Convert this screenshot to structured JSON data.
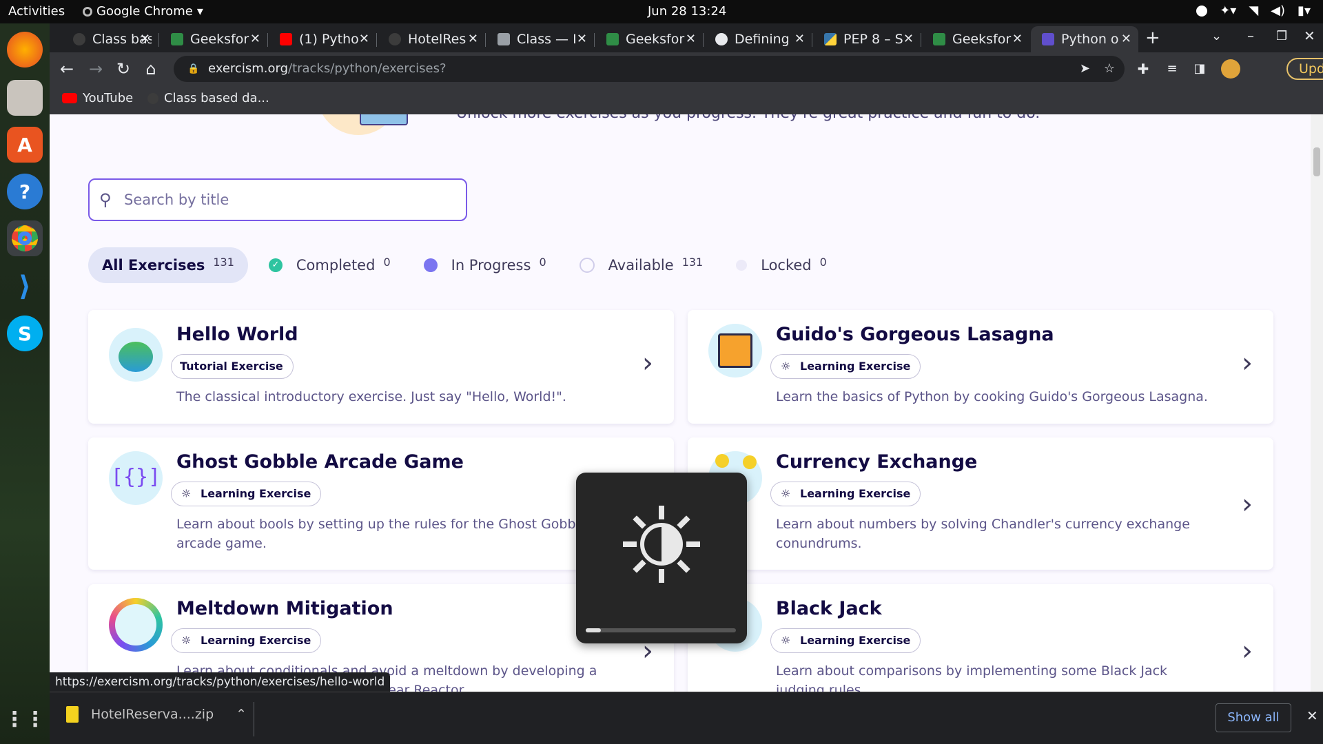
{
  "topbar": {
    "activities": "Activities",
    "app": "Google Chrome",
    "clock": "Jun 28  13:24"
  },
  "tabs": [
    {
      "label": "Class bas",
      "icon": "github-icon"
    },
    {
      "label": "Geeksfor",
      "icon": "geeksforgeeks-icon"
    },
    {
      "label": "(1) Pytho",
      "icon": "youtube-icon"
    },
    {
      "label": "HotelRes",
      "icon": "github-icon"
    },
    {
      "label": "Class — I",
      "icon": "doc-icon"
    },
    {
      "label": "Geeksfor",
      "icon": "geeksforgeeks-icon"
    },
    {
      "label": "Defining",
      "icon": "python-icon"
    },
    {
      "label": "PEP 8 – S",
      "icon": "python-icon"
    },
    {
      "label": "Geeksfor",
      "icon": "geeksforgeeks-icon"
    },
    {
      "label": "Python o",
      "icon": "exercism-icon"
    }
  ],
  "omnibar": {
    "host": "exercism.org",
    "path": "/tracks/python/exercises?",
    "update": "Update"
  },
  "bookmarks": [
    {
      "label": "YouTube"
    },
    {
      "label": "Class based da..."
    }
  ],
  "page": {
    "intro": "Unlock more exercises as you progress. They're great practice and fun to do.",
    "search_placeholder": "Search by title",
    "filters": [
      {
        "label": "All Exercises",
        "count": "131"
      },
      {
        "label": "Completed",
        "count": "0"
      },
      {
        "label": "In Progress",
        "count": "0"
      },
      {
        "label": "Available",
        "count": "131"
      },
      {
        "label": "Locked",
        "count": "0"
      }
    ],
    "cards": [
      {
        "title": "Hello World",
        "badge": "Tutorial Exercise",
        "desc": "The classical introductory exercise. Just say \"Hello, World!\"."
      },
      {
        "title": "Guido's Gorgeous Lasagna",
        "badge": "Learning Exercise",
        "desc": "Learn the basics of Python by cooking Guido's Gorgeous Lasagna."
      },
      {
        "title": "Ghost Gobble Arcade Game",
        "badge": "Learning Exercise",
        "desc": "Learn about bools by setting up the rules for the Ghost Gobble arcade game."
      },
      {
        "title": "Currency Exchange",
        "badge": "Learning Exercise",
        "desc": "Learn about numbers by solving Chandler's currency exchange conundrums."
      },
      {
        "title": "Meltdown Mitigation",
        "badge": "Learning Exercise",
        "desc": "Learn about conditionals and avoid a meltdown by developing a simple control system for a Nuclear Reactor."
      },
      {
        "title": "Black Jack",
        "badge": "Learning Exercise",
        "desc": "Learn about comparisons by implementing some Black Jack judging rules."
      }
    ]
  },
  "status_url": "https://exercism.org/tracks/python/exercises/hello-world",
  "brightness": {
    "level": 0.1
  },
  "downloads": {
    "file": "HotelReserva....zip",
    "show_all": "Show all"
  }
}
